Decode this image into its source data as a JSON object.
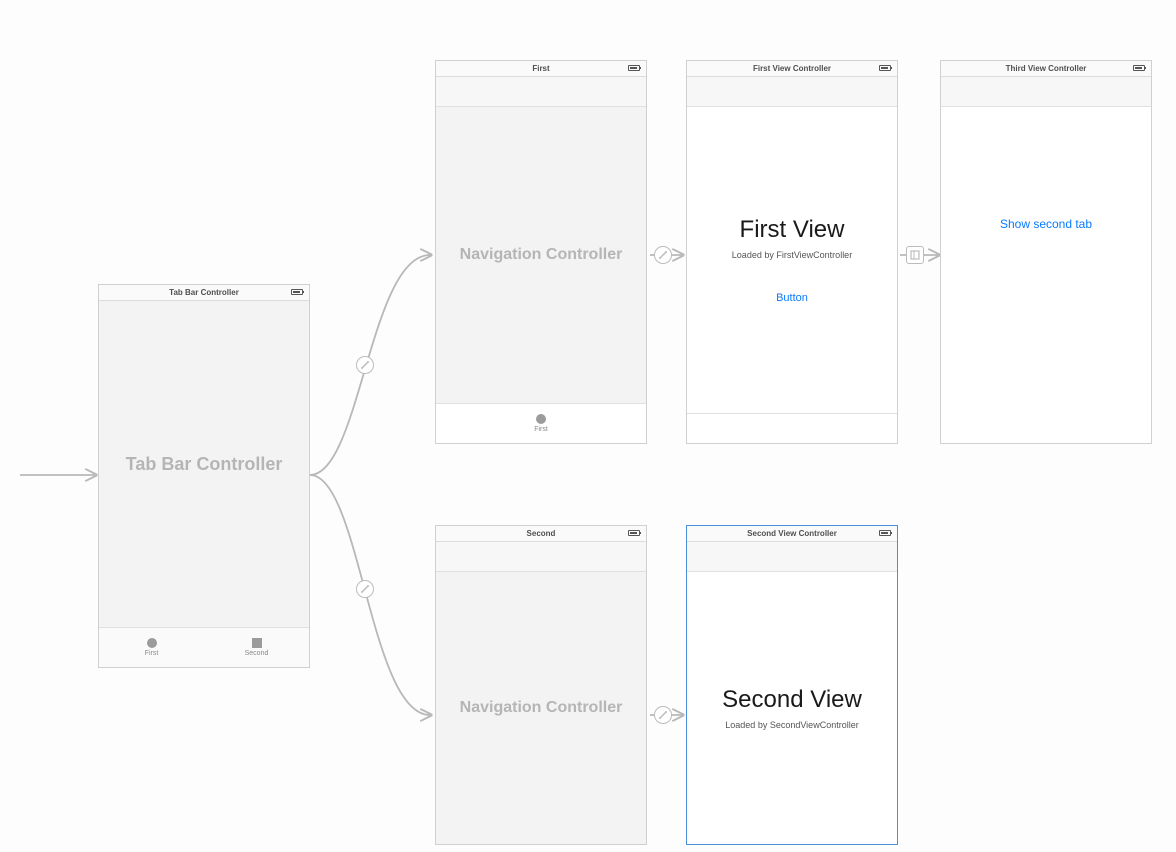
{
  "tabbar_scene": {
    "title": "Tab Bar Controller",
    "center_text": "Tab Bar Controller",
    "tabs": [
      {
        "label": "First"
      },
      {
        "label": "Second"
      }
    ]
  },
  "nav1": {
    "title": "First",
    "center_text": "Navigation Controller",
    "tab_label": "First"
  },
  "first_vc": {
    "title": "First View Controller",
    "heading": "First View",
    "subtitle": "Loaded by FirstViewController",
    "button_label": "Button"
  },
  "third_vc": {
    "title": "Third View Controller",
    "link_label": "Show second tab"
  },
  "nav2": {
    "title": "Second",
    "center_text": "Navigation Controller"
  },
  "second_vc": {
    "title": "Second View Controller",
    "heading": "Second View",
    "subtitle": "Loaded by SecondViewController"
  }
}
